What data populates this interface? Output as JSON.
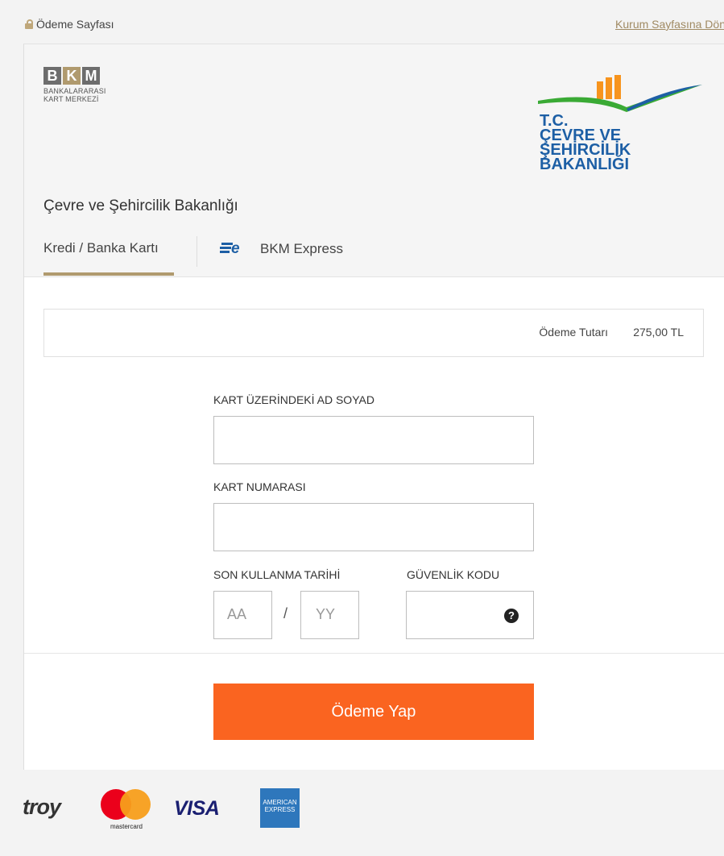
{
  "topbar": {
    "page_label": "Ödeme Sayfası",
    "back_link": "Kurum Sayfasına Dön"
  },
  "header": {
    "bkm_logo": {
      "letters": [
        "B",
        "K",
        "M"
      ],
      "line1": "BANKALARARASI",
      "line2": "KART MERKEZİ"
    },
    "ministry_logo": {
      "line1": "T.C.",
      "line2": "ÇEVRE VE ŞEHİRCİLİK",
      "line3": "BAKANLIĞI"
    },
    "merchant_name": "Çevre ve Şehircilik Bakanlığı"
  },
  "tabs": [
    {
      "label": "Kredi / Banka Kartı",
      "active": true
    },
    {
      "label": "BKM Express",
      "active": false,
      "icon": "bkm-express-icon"
    }
  ],
  "amount": {
    "label": "Ödeme Tutarı",
    "value": "275,00 TL"
  },
  "form": {
    "name_label": "KART ÜZERİNDEKİ AD SOYAD",
    "name_value": "",
    "number_label": "KART NUMARASI",
    "number_value": "",
    "expiry_label": "SON KULLANMA TARİHİ",
    "month_placeholder": "AA",
    "separator": "/",
    "year_placeholder": "YY",
    "cvv_label": "GÜVENLİK KODU",
    "cvv_value": "",
    "help_icon": "question-circle-icon"
  },
  "pay_button": "Ödeme Yap",
  "brands": {
    "troy": "troy",
    "mastercard": "mastercard",
    "visa": "VISA",
    "amex_line1": "AMERICAN",
    "amex_line2": "EXPRESS"
  },
  "colors": {
    "accent_gold": "#b09a6e",
    "pay_button": "#fa6420",
    "ministry_blue": "#1d5fa5",
    "ministry_orange": "#f7941d",
    "ministry_green": "#3aaa35"
  }
}
